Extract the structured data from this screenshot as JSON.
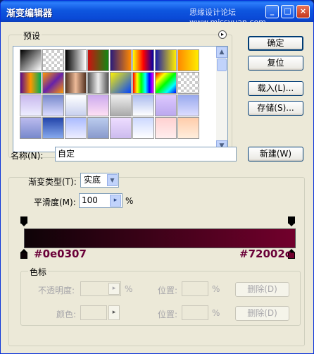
{
  "window": {
    "title": "渐变编辑器",
    "watermark": "思缘设计论坛 www.missyuan.com"
  },
  "presets": {
    "label": "预设",
    "menu_icon": "circle-arrow-icon"
  },
  "buttons": {
    "ok": "确定",
    "reset": "复位",
    "load": "载入(L)...",
    "save": "存储(S)...",
    "new": "新建(W)"
  },
  "name": {
    "label": "名称(N):",
    "value": "自定"
  },
  "gradient_type": {
    "label": "渐变类型(T):",
    "value": "实底"
  },
  "smoothness": {
    "label": "平滑度(M):",
    "value": "100",
    "unit": "%"
  },
  "gradient": {
    "start_color": "#0e0307",
    "end_color": "#72002c",
    "start_label": "#0e0307",
    "end_label": "#72002c"
  },
  "stops": {
    "label": "色标",
    "opacity_label": "不透明度:",
    "opacity_unit": "%",
    "color_label": "颜色:",
    "location_label": "位置:",
    "location_unit": "%",
    "location_label2": "位置:",
    "location_unit2": "%",
    "delete": "删除(D)",
    "delete2": "删除(D)"
  },
  "swatch_colors": [
    "linear-gradient(135deg,#000,#fff)",
    "repeating-conic-gradient(#ccc 0 25%,#fff 0 50%) 0 0/8px 8px",
    "linear-gradient(90deg,#000,#fff)",
    "linear-gradient(90deg,#cc1111,#118811)",
    "linear-gradient(90deg,#2a1a7a,#ff8800)",
    "linear-gradient(90deg,#ffff00,#ff0000,#0000aa)",
    "linear-gradient(90deg,#1a1aaa,#ffee00)",
    "linear-gradient(90deg,#ff8800,#ffee00)",
    "linear-gradient(90deg,#5a0a8a,#ff9900,#00aa55)",
    "linear-gradient(135deg,#ff9900,#6622aa,#ff9900)",
    "linear-gradient(90deg,#553322,#eebb99,#553322)",
    "linear-gradient(90deg,#555,#eee,#555)",
    "linear-gradient(135deg,#fff200,#0044ff)",
    "linear-gradient(90deg,#f00,#ff0,#0f0,#0ff,#00f,#f0f)",
    "linear-gradient(135deg,#f00,#ff0,#0f0,#0ff,#00f)",
    "repeating-conic-gradient(#ccc 0 25%,#fff 0 50%) 0 0/8px 8px",
    "linear-gradient(180deg,#c8b8ee,#eeeeff)",
    "linear-gradient(180deg,#7788cc,#ddddff)",
    "linear-gradient(180deg,#ffffff,#c8d0ee)",
    "linear-gradient(180deg,#ccaaee,#ffe0f4)",
    "linear-gradient(180deg,#eee,#aaa)",
    "linear-gradient(180deg,#aabbee,#ffffff)",
    "linear-gradient(180deg,#ddc8ff,#bba8ee)",
    "linear-gradient(180deg,#99aaee,#ddddff)",
    "linear-gradient(180deg,#bbbbee,#7788cc)",
    "linear-gradient(180deg,#2244aa,#88aaee)",
    "linear-gradient(180deg,#aabbff,#eeeeff)",
    "linear-gradient(180deg,#bbccee,#8899cc)",
    "linear-gradient(180deg,#eeddff,#ccbbee)",
    "linear-gradient(180deg,#ccd8ff,#ffffff)",
    "linear-gradient(180deg,#ffd0d0,#ffeeee)",
    "linear-gradient(180deg,#ffccaa,#ffeedd)"
  ]
}
